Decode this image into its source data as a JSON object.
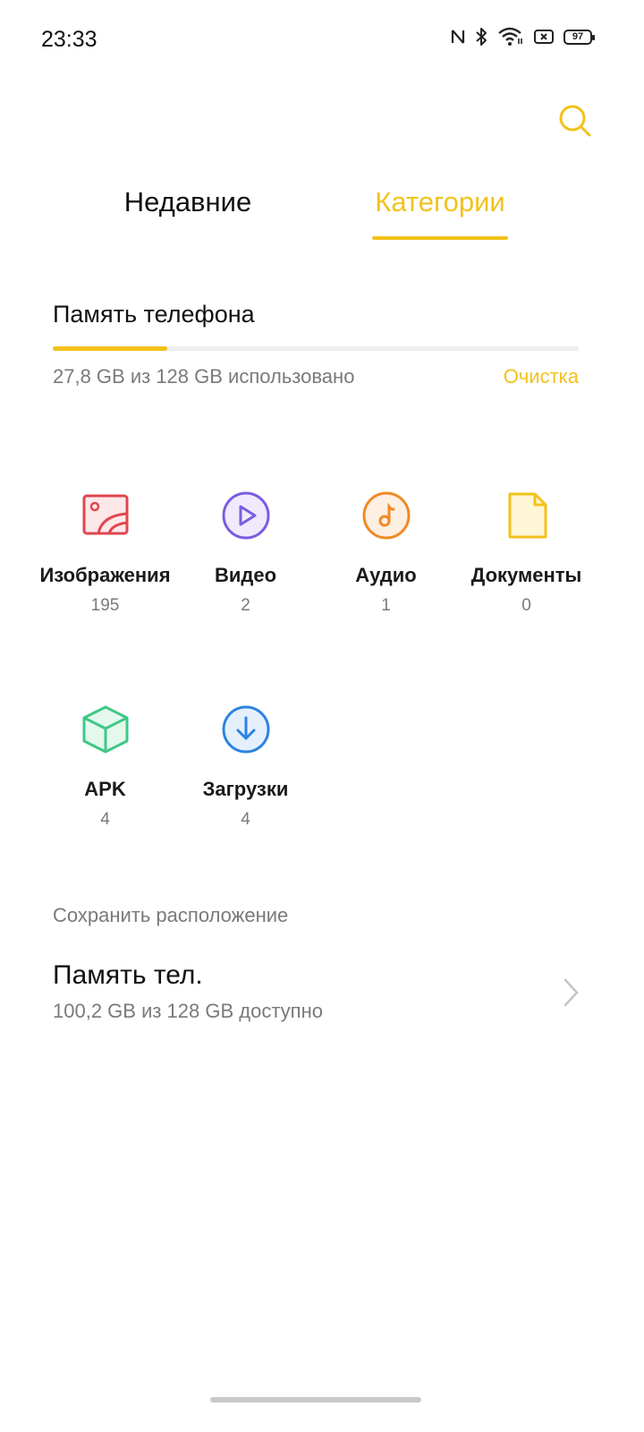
{
  "status_bar": {
    "time": "23:33",
    "battery": "97",
    "icons": [
      "nfc-icon",
      "bluetooth-icon",
      "wifi-icon",
      "sim-error-icon",
      "battery-icon"
    ]
  },
  "toolbar": {
    "search_icon": "search-icon"
  },
  "tabs": [
    {
      "label": "Недавние",
      "active": false
    },
    {
      "label": "Категории",
      "active": true
    }
  ],
  "storage": {
    "title": "Память телефона",
    "usage_text": "27,8 GB из 128 GB использовано",
    "used_fraction": 0.217,
    "clean_label": "Очистка"
  },
  "categories": [
    {
      "label": "Изображения",
      "count": "195",
      "icon": "image-icon",
      "color": "#e0464f"
    },
    {
      "label": "Видео",
      "count": "2",
      "icon": "video-icon",
      "color": "#7a5ce0"
    },
    {
      "label": "Аудио",
      "count": "1",
      "icon": "audio-icon",
      "color": "#f08a24"
    },
    {
      "label": "Документы",
      "count": "0",
      "icon": "document-icon",
      "color": "#f2c21b"
    },
    {
      "label": "APK",
      "count": "4",
      "icon": "apk-icon",
      "color": "#3fc887"
    },
    {
      "label": "Загрузки",
      "count": "4",
      "icon": "download-icon",
      "color": "#2c84e0"
    }
  ],
  "save_location": {
    "section_label": "Сохранить расположение",
    "item_title": "Память тел.",
    "item_subtitle": "100,2 GB из 128 GB доступно"
  },
  "colors": {
    "accent": "#f2c21b",
    "text_primary": "#111111",
    "text_secondary": "#7a7a7a"
  }
}
